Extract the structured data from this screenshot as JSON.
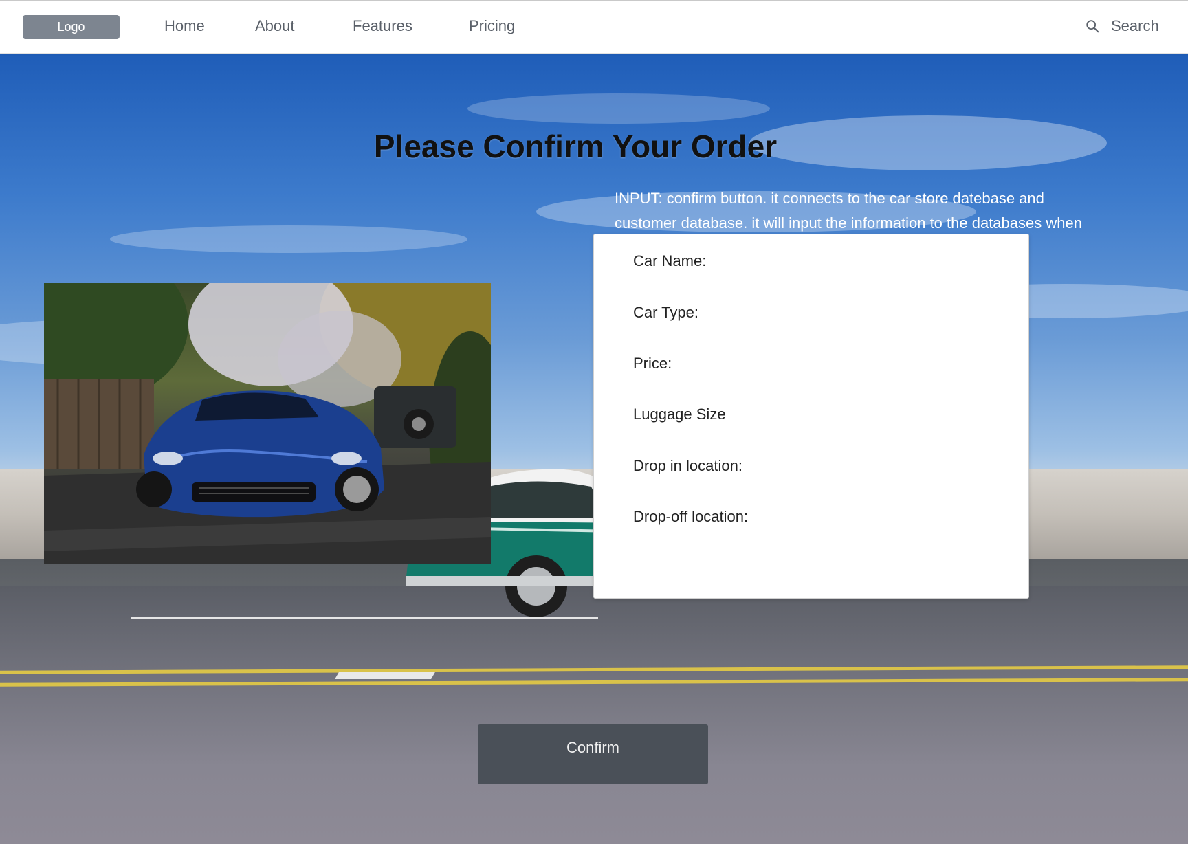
{
  "nav": {
    "logo": "Logo",
    "links": [
      "Home",
      "About",
      "Features",
      "Pricing"
    ],
    "search_label": "Search"
  },
  "page": {
    "title": "Please Confirm Your Order",
    "note": "INPUT: confirm button. it connects to the car store datebase and customer database. it will input the information to the databases when click the confirm button"
  },
  "order": {
    "fields": [
      "Car Name:",
      "Car Type:",
      "Price:",
      "Luggage Size",
      "Drop in location:",
      "Drop-off location:"
    ]
  },
  "confirm_label": "Confirm",
  "colors": {
    "logo_bg": "#7d8590",
    "nav_text": "#5a6069",
    "button_bg": "#4a5058",
    "card_bg": "#ffffff"
  }
}
